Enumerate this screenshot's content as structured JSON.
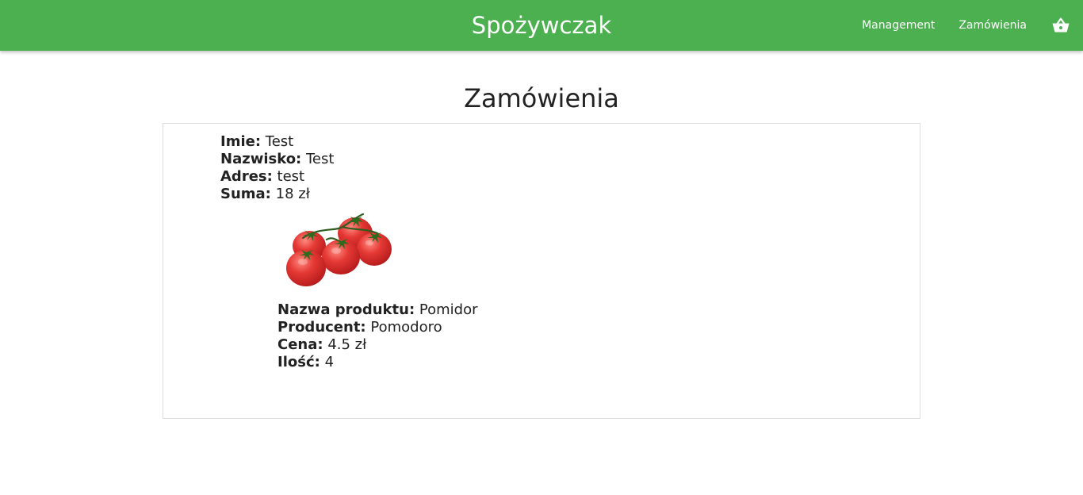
{
  "header": {
    "brand": "Spożywczak",
    "nav": [
      {
        "label": "Management"
      },
      {
        "label": "Zamówienia"
      }
    ],
    "cart_icon": "basket-icon",
    "bar_color": "#4caf50"
  },
  "main": {
    "title": "Zamówienia"
  },
  "order": {
    "first_name_label": "Imie:",
    "first_name": "Test",
    "last_name_label": "Nazwisko:",
    "last_name": "Test",
    "address_label": "Adres:",
    "address": "test",
    "total_label": "Suma:",
    "total": "18 zł",
    "items": [
      {
        "image": "tomato-image",
        "name_label": "Nazwa produktu:",
        "name": "Pomidor",
        "producer_label": "Producent:",
        "producer": "Pomodoro",
        "price_label": "Cena:",
        "price": "4.5 zł",
        "quantity_label": "Ilość:",
        "quantity": "4"
      }
    ]
  }
}
